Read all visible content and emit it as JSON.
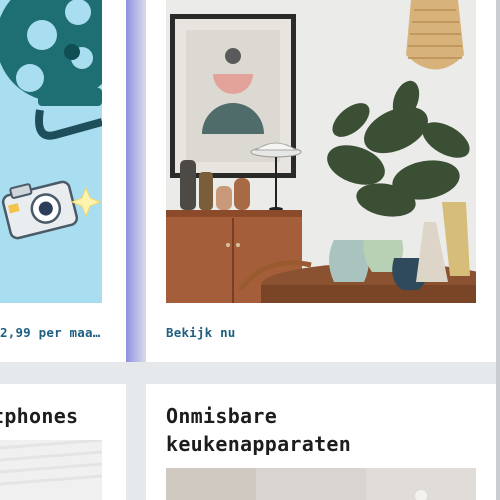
{
  "cards": {
    "top_left": {
      "link": "2,99 per maa…",
      "image": "movie-camera-illustration"
    },
    "top_right": {
      "link": "Bekijk nu",
      "image": "living-room-interior-photo"
    },
    "bottom_left": {
      "title": "tphones",
      "image": "smartphone-product-photo"
    },
    "bottom_right": {
      "title_line1": "Onmisbare",
      "title_line2": "keukenapparaten",
      "image": "kitchen-appliance-photo"
    }
  },
  "colors": {
    "page_bg": "#e6e9eb",
    "card_bg": "#ffffff",
    "link": "#1f5f82",
    "title": "#1d1d1d",
    "illustration_bg": "#a9def0"
  }
}
